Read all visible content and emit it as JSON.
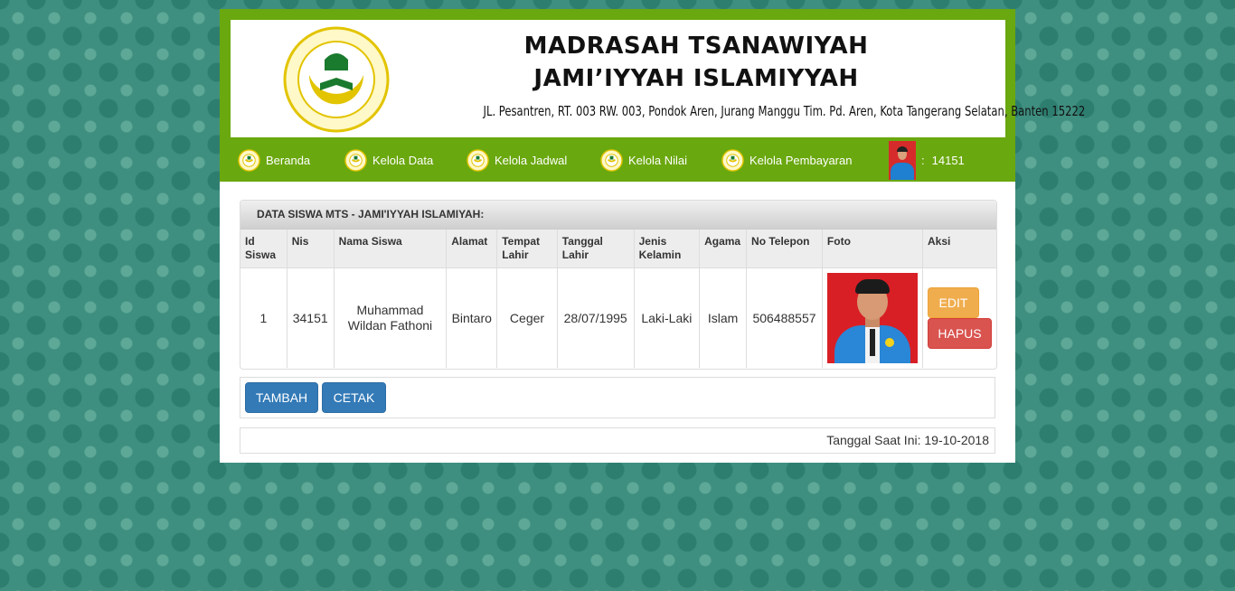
{
  "header": {
    "title_line1": "MADRASAH TSANAWIYAH",
    "title_line2": "JAMI’IYYAH ISLAMIYYAH",
    "address": "JL. Pesantren, RT. 003 RW. 003, Pondok Aren, Jurang Manggu Tim. Pd. Aren, Kota Tangerang Selatan, Banten 15222",
    "logo_text": "MTS. JAMI'IYYAH ISLAMIYYAH"
  },
  "nav": {
    "items": [
      {
        "label": "Beranda",
        "icon": "school-logo-icon"
      },
      {
        "label": "Kelola Data",
        "icon": "school-logo-icon"
      },
      {
        "label": "Kelola Jadwal",
        "icon": "school-logo-icon"
      },
      {
        "label": "Kelola Nilai",
        "icon": "school-logo-icon"
      },
      {
        "label": "Kelola Pembayaran",
        "icon": "school-logo-icon"
      }
    ],
    "user_separator": ":",
    "user_id": "14151"
  },
  "panel": {
    "title": "DATA SISWA MTS - JAMI'IYYAH ISLAMIYAH:",
    "columns": [
      "Id Siswa",
      "Nis",
      "Nama Siswa",
      "Alamat",
      "Tempat Lahir",
      "Tanggal Lahir",
      "Jenis Kelamin",
      "Agama",
      "No Telepon",
      "Foto",
      "Aksi"
    ],
    "rows": [
      {
        "id": "1",
        "nis": "34151",
        "nama": "Muhammad Wildan Fathoni",
        "alamat": "Bintaro",
        "tempat_lahir": "Ceger",
        "tanggal_lahir": "28/07/1995",
        "jenis_kelamin": "Laki-Laki",
        "agama": "Islam",
        "telepon": "506488557",
        "edit_label": "EDIT",
        "hapus_label": "HAPUS"
      }
    ]
  },
  "actions": {
    "tambah_label": "TAMBAH",
    "cetak_label": "CETAK"
  },
  "footer": {
    "date_text": "Tanggal Saat Ini: 19-10-2018"
  },
  "colors": {
    "header_green": "#6aa80f",
    "background_teal": "#3f8f80",
    "edit": "#f0ad4e",
    "hapus": "#d9534f",
    "primary": "#337ab7"
  }
}
